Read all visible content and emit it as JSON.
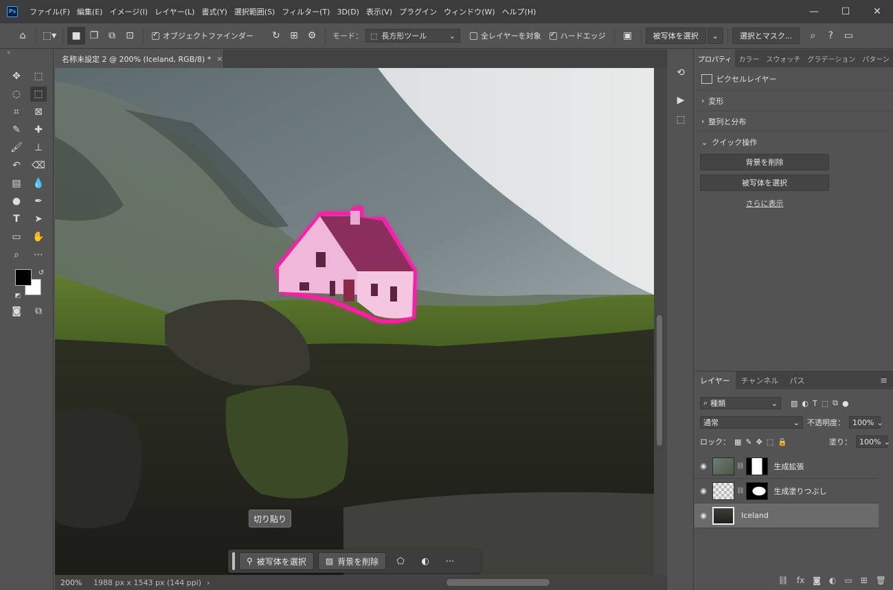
{
  "app": {
    "logo": "Ps"
  },
  "menu": [
    "ファイル(F)",
    "編集(E)",
    "イメージ(I)",
    "レイヤー(L)",
    "書式(Y)",
    "選択範囲(S)",
    "フィルター(T)",
    "3D(D)",
    "表示(V)",
    "プラグイン",
    "ウィンドウ(W)",
    "ヘルプ(H)"
  ],
  "options": {
    "object_finder": "オブジェクトファインダー",
    "mode_label": "モード：",
    "mode_value": "長方形ツール",
    "all_layers": "全レイヤーを対象",
    "hard_edge": "ハードエッジ",
    "select_subject": "被写体を選択",
    "select_and_mask": "選択とマスク..."
  },
  "document": {
    "tab_title": "名称未設定 2 @ 200% (Iceland, RGB/8) *",
    "zoom": "200%",
    "size": "1988 px x 1543 px (144 ppi)"
  },
  "tooltip": "切り貼り",
  "taskbar": {
    "select_subject": "被写体を選択",
    "remove_background": "背景を削除"
  },
  "properties": {
    "tabs": [
      "プロパティ",
      "カラー",
      "スウォッチ",
      "グラデーション",
      "パターン"
    ],
    "layer_type": "ピクセルレイヤー",
    "sections": [
      "変形",
      "整列と分布",
      "クイック操作"
    ],
    "remove_bg": "背景を削除",
    "select_subject": "被写体を選択",
    "show_more": "さらに表示"
  },
  "layers": {
    "tabs": [
      "レイヤー",
      "チャンネル",
      "パス"
    ],
    "filter": "種類",
    "blend": "通常",
    "opacity_label": "不透明度：",
    "opacity": "100%",
    "lock_label": "ロック：",
    "fill_label": "塗り：",
    "fill": "100%",
    "items": [
      {
        "name": "生成拡張"
      },
      {
        "name": "生成塗りつぶし"
      },
      {
        "name": "Iceland"
      }
    ]
  },
  "colors": {
    "selection_glow": "#ff1aa8",
    "panel_bg": "#535353",
    "menu_bg": "#3c3c3c"
  }
}
